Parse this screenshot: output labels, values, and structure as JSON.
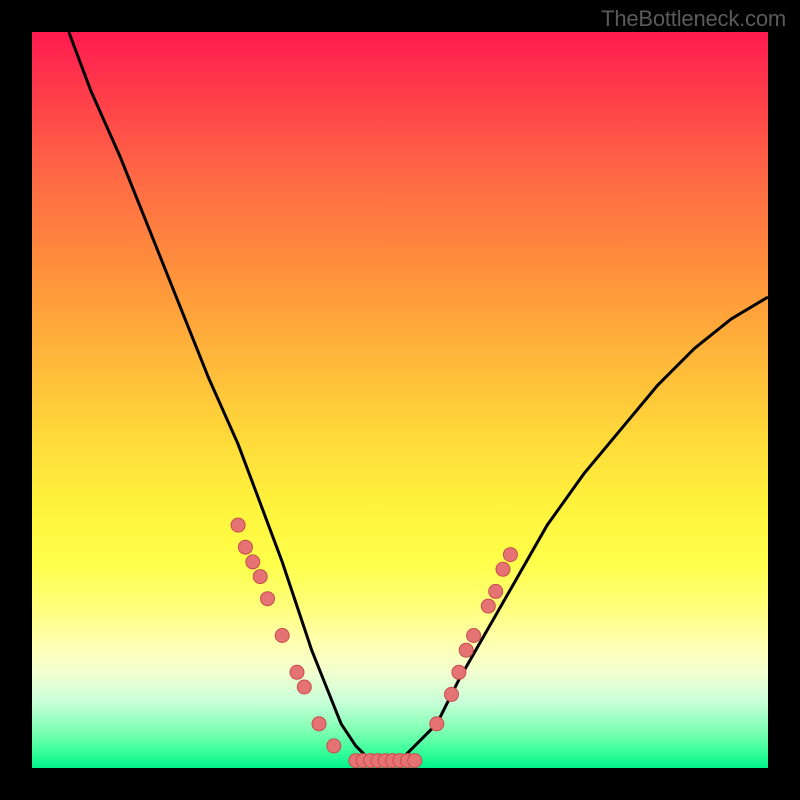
{
  "attribution": "TheBottleneck.com",
  "colors": {
    "frame": "#000000",
    "curve": "#000000",
    "dot_fill": "#e57373",
    "dot_stroke": "#c94c4c",
    "grad_top": "#ff1a4f",
    "grad_bottom": "#00f08a"
  },
  "chart_data": {
    "type": "line",
    "title": "",
    "xlabel": "",
    "ylabel": "",
    "xlim": [
      0,
      100
    ],
    "ylim": [
      0,
      100
    ],
    "grid": false,
    "legend": false,
    "series": [
      {
        "name": "bottleneck-curve",
        "x": [
          5,
          8,
          12,
          16,
          20,
          24,
          28,
          31,
          34,
          36,
          38,
          40,
          42,
          44,
          46,
          48,
          50,
          52,
          55,
          58,
          62,
          66,
          70,
          75,
          80,
          85,
          90,
          95,
          100
        ],
        "y": [
          100,
          92,
          83,
          73,
          63,
          53,
          44,
          36,
          28,
          22,
          16,
          11,
          6,
          3,
          1,
          1,
          1,
          3,
          6,
          12,
          19,
          26,
          33,
          40,
          46,
          52,
          57,
          61,
          64
        ]
      }
    ],
    "markers": [
      {
        "name": "left-cluster",
        "x": 28,
        "y": 33
      },
      {
        "name": "left-cluster",
        "x": 29,
        "y": 30
      },
      {
        "name": "left-cluster",
        "x": 30,
        "y": 28
      },
      {
        "name": "left-cluster",
        "x": 31,
        "y": 26
      },
      {
        "name": "left-cluster",
        "x": 32,
        "y": 23
      },
      {
        "name": "left-cluster",
        "x": 34,
        "y": 18
      },
      {
        "name": "left-cluster",
        "x": 36,
        "y": 13
      },
      {
        "name": "left-cluster",
        "x": 37,
        "y": 11
      },
      {
        "name": "left-cluster",
        "x": 39,
        "y": 6
      },
      {
        "name": "left-cluster",
        "x": 41,
        "y": 3
      },
      {
        "name": "bottom-cluster",
        "x": 44,
        "y": 1
      },
      {
        "name": "bottom-cluster",
        "x": 45,
        "y": 1
      },
      {
        "name": "bottom-cluster",
        "x": 46,
        "y": 1
      },
      {
        "name": "bottom-cluster",
        "x": 47,
        "y": 1
      },
      {
        "name": "bottom-cluster",
        "x": 48,
        "y": 1
      },
      {
        "name": "bottom-cluster",
        "x": 49,
        "y": 1
      },
      {
        "name": "bottom-cluster",
        "x": 50,
        "y": 1
      },
      {
        "name": "bottom-cluster",
        "x": 51,
        "y": 1
      },
      {
        "name": "bottom-cluster",
        "x": 52,
        "y": 1
      },
      {
        "name": "right-cluster",
        "x": 55,
        "y": 6
      },
      {
        "name": "right-cluster",
        "x": 57,
        "y": 10
      },
      {
        "name": "right-cluster",
        "x": 58,
        "y": 13
      },
      {
        "name": "right-cluster",
        "x": 59,
        "y": 16
      },
      {
        "name": "right-cluster",
        "x": 60,
        "y": 18
      },
      {
        "name": "right-cluster",
        "x": 62,
        "y": 22
      },
      {
        "name": "right-cluster",
        "x": 63,
        "y": 24
      },
      {
        "name": "right-cluster",
        "x": 64,
        "y": 27
      },
      {
        "name": "right-cluster",
        "x": 65,
        "y": 29
      }
    ]
  }
}
